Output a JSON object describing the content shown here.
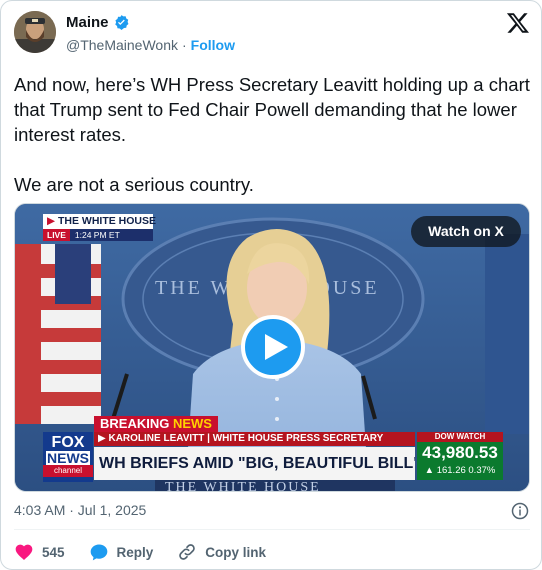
{
  "author": {
    "name": "Maine",
    "handle": "@TheMaineWonk",
    "separator": "·",
    "follow_label": "Follow"
  },
  "tweet": {
    "text": "And now, here’s WH Press Secretary Leavitt holding up a chart that Trump sent to Fed Chair Powell demanding that he lower interest rates.\n\nWe are not a serious country."
  },
  "video": {
    "watch_label": "Watch on X",
    "location": "THE WHITE HOUSE",
    "live_tag": "LIVE",
    "live_time": "1:24 PM ET",
    "seal_text": "THE WHITE HOUSE",
    "breaking_label": "BREAKING",
    "news_label": "NEWS",
    "subline": "KAROLINE LEAVITT | WHITE HOUSE PRESS SECRETARY",
    "headline": "WH BRIEFS AMID \"BIG, BEAUTIFUL BILL\" MARATHON VOTE",
    "dow_label": "DOW WATCH",
    "dow_value": "43,980.53",
    "dow_change": "▲ 161.26 0.37%",
    "channel_top": "FOX",
    "channel_mid": "NEWS",
    "channel_bottom": "channel"
  },
  "meta": {
    "timestamp": "4:03 AM · Jul 1, 2025"
  },
  "actions": {
    "likes": "545",
    "reply_label": "Reply",
    "copy_label": "Copy link"
  },
  "colors": {
    "accent": "#1d9bf0",
    "like": "#f91880",
    "muted": "#536471"
  },
  "icons": [
    "verified-badge-icon",
    "x-logo-icon",
    "play-icon",
    "info-icon",
    "heart-icon",
    "reply-icon",
    "link-icon"
  ]
}
